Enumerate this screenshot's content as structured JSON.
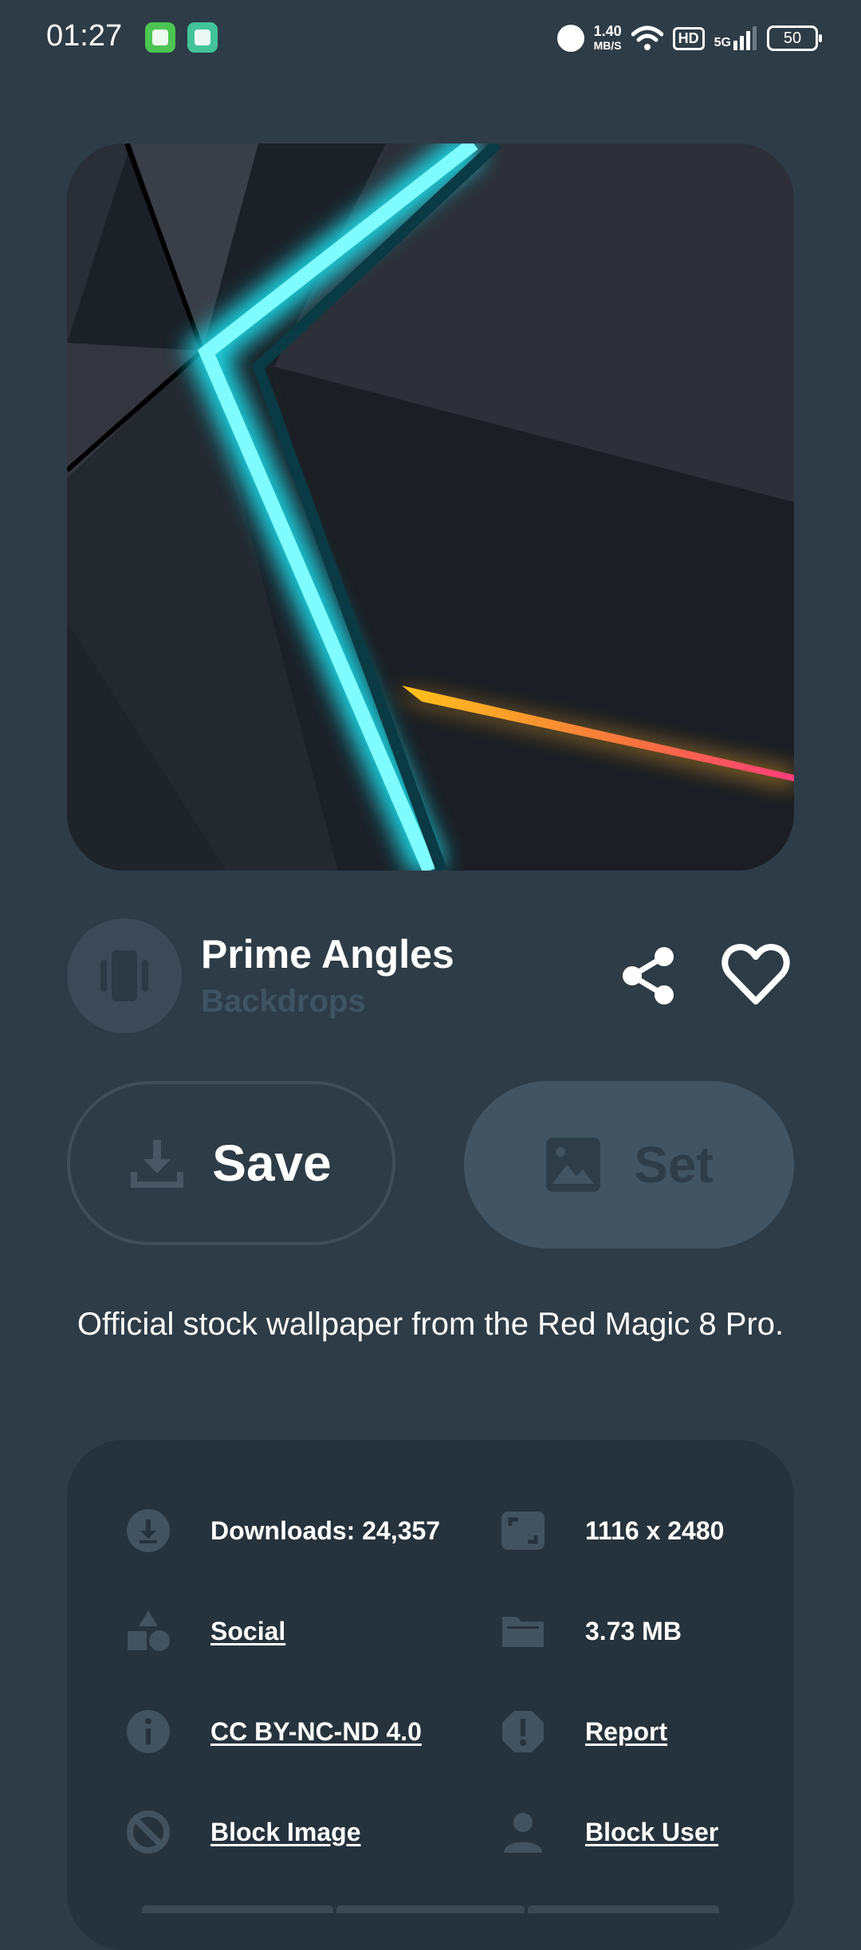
{
  "status_bar": {
    "time": "01:27",
    "speed_value": "1.40",
    "speed_unit": "MB/S",
    "hd": "HD",
    "network": "5G",
    "battery": "50"
  },
  "wallpaper": {
    "title": "Prime Angles",
    "collection": "Backdrops",
    "description": "Official stock wallpaper from the Red Magic 8 Pro."
  },
  "actions": {
    "save_label": "Save",
    "set_label": "Set"
  },
  "info": {
    "downloads": "Downloads: 24,357",
    "resolution": "1116 x 2480",
    "category": "Social",
    "size": "3.73 MB",
    "license": "CC BY-NC-ND 4.0",
    "report": "Report",
    "block_image": "Block Image",
    "block_user": "Block User"
  },
  "icons": {
    "share": "share-icon",
    "favorite": "heart-icon",
    "download": "download-icon",
    "image": "image-icon",
    "resolution": "aspect-ratio-icon",
    "category": "shapes-icon",
    "size": "folder-icon",
    "license": "info-icon",
    "report": "alert-icon",
    "block_image": "block-icon",
    "block_user": "person-icon"
  },
  "colors": {
    "background": "#2e3c47",
    "card": "#26323c",
    "accent_cyan": "#3ff5ff",
    "muted_icon": "#42525e"
  }
}
